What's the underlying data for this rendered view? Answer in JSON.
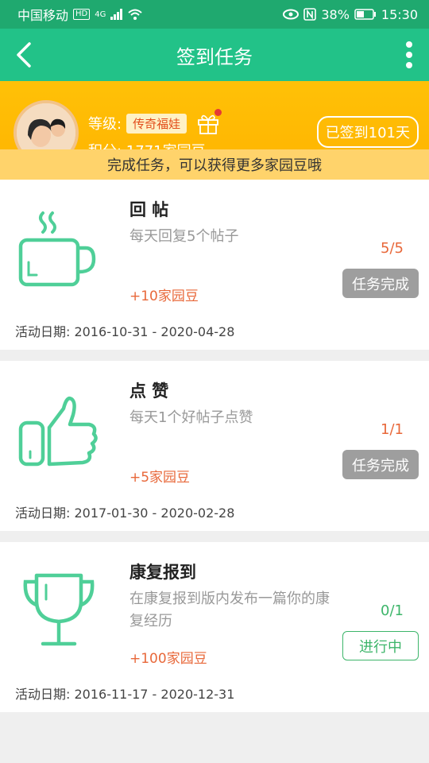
{
  "statusbar": {
    "carrier": "中国移动",
    "net": "4G",
    "battery": "38%",
    "time": "15:30"
  },
  "header": {
    "title": "签到任务"
  },
  "profile": {
    "level_label": "等级:",
    "level_value": "传奇福娃",
    "score": "积分: 1771家园豆",
    "signed": "已签到101天",
    "notice": "完成任务，可以获得更多家园豆哦"
  },
  "tasks": [
    {
      "icon": "cup-icon",
      "title": "回 帖",
      "desc": "每天回复5个帖子",
      "reward": "+10家园豆",
      "progress": "5/5",
      "button": "任务完成",
      "date": "活动日期: 2016-10-31 - 2020-04-28"
    },
    {
      "icon": "thumbs-up-icon",
      "title": "点 赞",
      "desc": "每天1个好帖子点赞",
      "reward": "+5家园豆",
      "progress": "1/1",
      "button": "任务完成",
      "date": "活动日期: 2017-01-30 - 2020-02-28"
    },
    {
      "icon": "trophy-icon",
      "title": "康复报到",
      "desc": "在康复报到版内发布一篇你的康复经历",
      "reward": "+100家园豆",
      "progress": "0/1",
      "button": "进行中",
      "date": "活动日期: 2016-11-17 - 2020-12-31"
    }
  ],
  "colors": {
    "primary": "#22c288",
    "orange": "#ffb300",
    "reward": "#e8683a",
    "done": "#9e9e9e",
    "active": "#3db56a"
  }
}
